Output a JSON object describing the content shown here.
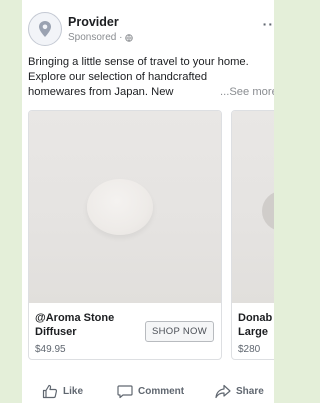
{
  "post": {
    "page_name": "Provider",
    "sponsored": "Sponsored ·",
    "caption_lines": [
      "Bringing a little sense of travel to your home.",
      "Explore our selection of handcrafted",
      "homewares from Japan. New"
    ],
    "see_more": "...See more"
  },
  "carousel": {
    "cards": [
      {
        "title": "@Aroma Stone\nDiffuser",
        "price": "$49.95",
        "button": "SHOP NOW"
      },
      {
        "title": "Donab\nLarge",
        "price": "$280"
      }
    ]
  },
  "actions": {
    "like": "Like",
    "comment": "Comment",
    "share": "Share"
  },
  "colors": {
    "background": "#e4efd9",
    "text": "#1c1e21",
    "muted": "#8a8d91"
  }
}
